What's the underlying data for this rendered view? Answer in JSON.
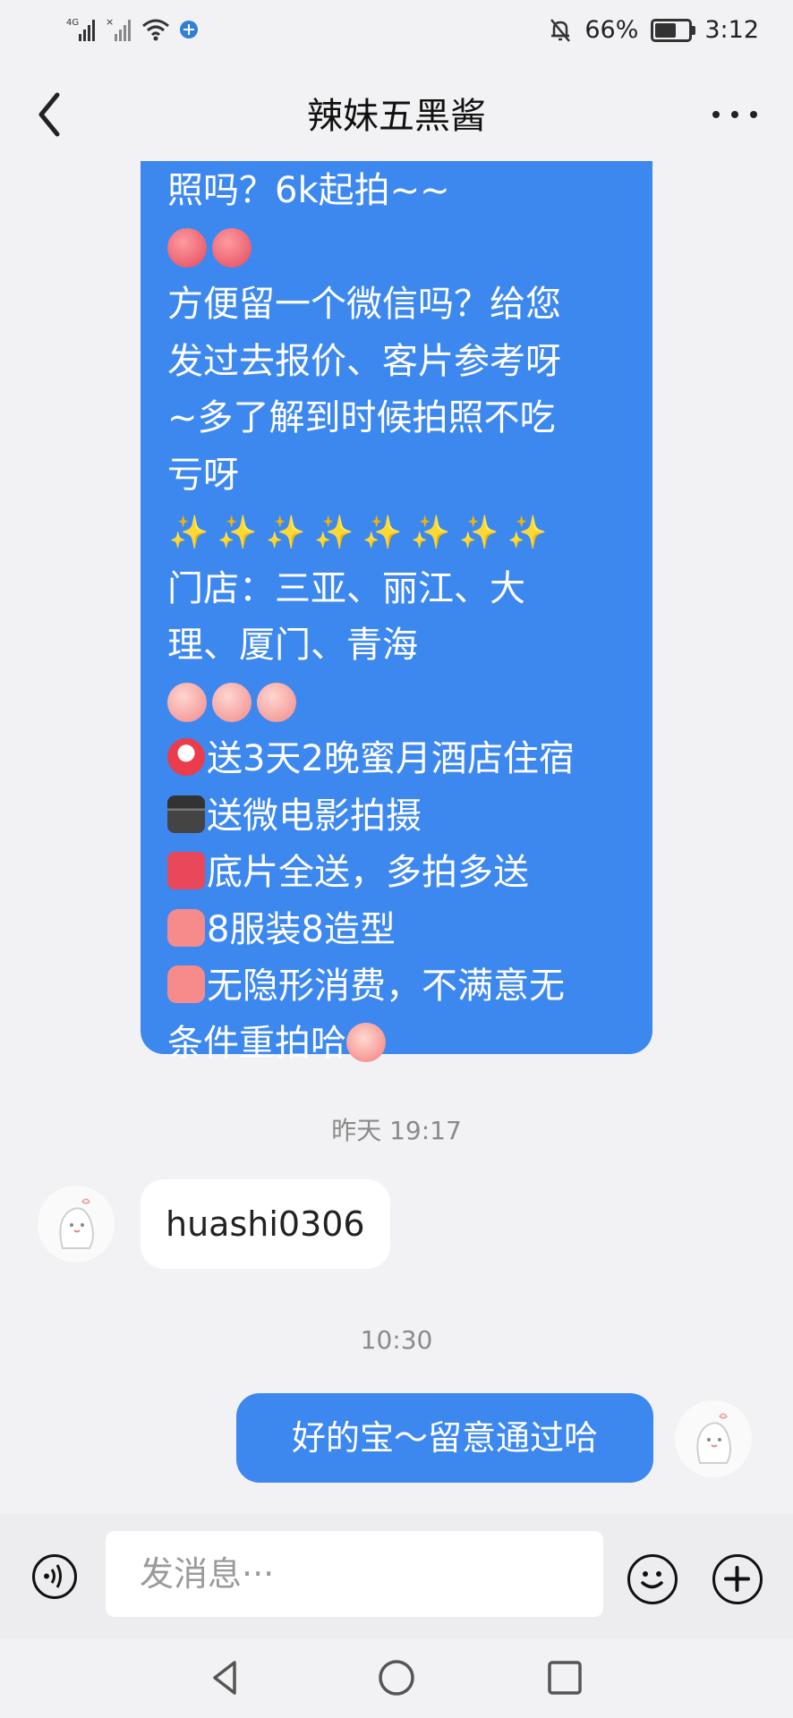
{
  "status_bar": {
    "network1": "4G",
    "network2": "×",
    "battery": "66%",
    "battery_level": 0.66,
    "time": "3:12"
  },
  "header": {
    "title": "辣妹五黑酱"
  },
  "messages": {
    "big_bubble": {
      "line1": "照吗？6k起拍~~",
      "line2": "方便留一个微信吗？给您",
      "line3": "发过去报价、客片参考呀",
      "line4": "~多了解到时候拍照不吃",
      "line5": "亏呀",
      "line6": "门店：三亚、丽江、大",
      "line7": "理、厦门、青海",
      "line8": "送3天2晚蜜月酒店住宿",
      "line9": "送微电影拍摄",
      "line10": "底片全送，多拍多送",
      "line11": "8服装8造型",
      "line12": "无隐形消费，不满意无",
      "line13": "条件重拍哈",
      "sparkles": [
        "✨",
        "✨",
        "✨",
        "✨",
        "✨",
        "✨",
        "✨",
        "✨"
      ]
    },
    "timestamp1": "昨天 19:17",
    "incoming_text": "huashi0306",
    "timestamp2": "10:30",
    "outgoing_text": "好的宝～留意通过哈"
  },
  "input": {
    "placeholder": "发消息···"
  },
  "colors": {
    "bubble_blue": "#3d88ef",
    "background": "#f2f2f4"
  },
  "icons": [
    "back-arrow-icon",
    "more-icon",
    "voice-icon",
    "emoji-icon",
    "plus-icon",
    "nav-back-icon",
    "nav-home-icon",
    "nav-recent-icon"
  ]
}
